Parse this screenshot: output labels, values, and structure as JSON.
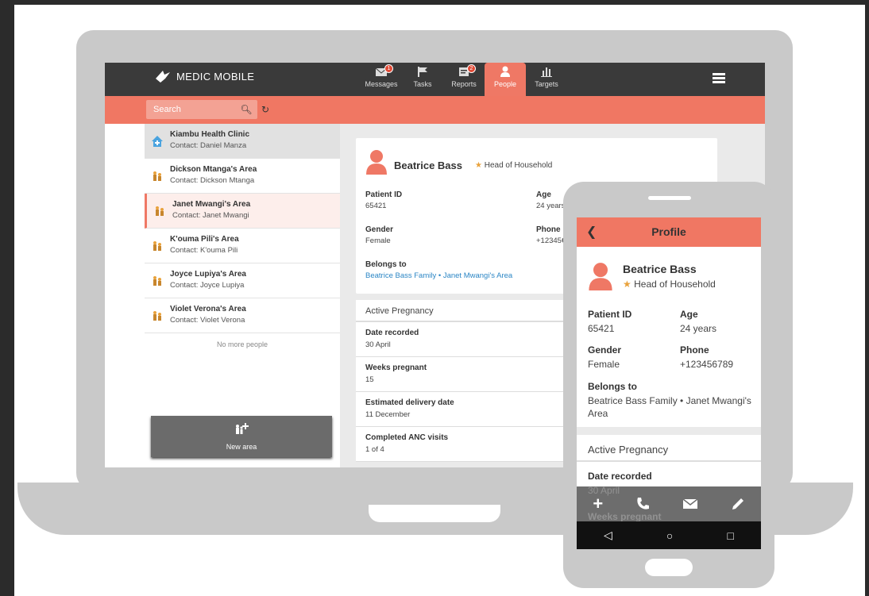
{
  "app": {
    "logo_text": "MEDIC MOBILE",
    "accent": "#f07763",
    "dark": "#3a3a3a"
  },
  "tabs": [
    {
      "label": "Messages",
      "icon": "envelope-icon",
      "badge": "1"
    },
    {
      "label": "Tasks",
      "icon": "flag-icon"
    },
    {
      "label": "Reports",
      "icon": "report-icon",
      "badge": "2"
    },
    {
      "label": "People",
      "icon": "person-icon",
      "active": true
    },
    {
      "label": "Targets",
      "icon": "bar-chart-icon"
    }
  ],
  "search": {
    "placeholder": "Search"
  },
  "people": [
    {
      "title": "Kiambu Health Clinic",
      "contact": "Contact: Daniel Manza",
      "icon": "clinic-icon"
    },
    {
      "title": "Dickson Mtanga's Area",
      "contact": "Contact: Dickson Mtanga",
      "icon": "family-icon"
    },
    {
      "title": "Janet Mwangi's Area",
      "contact": "Contact: Janet Mwangi",
      "icon": "family-icon"
    },
    {
      "title": "K'ouma Pili's Area",
      "contact": "Contact: K'ouma Pili",
      "icon": "family-icon"
    },
    {
      "title": "Joyce Lupiya's Area",
      "contact": "Contact: Joyce Lupiya",
      "icon": "family-icon"
    },
    {
      "title": "Violet Verona's Area",
      "contact": "Contact: Violet Verona",
      "icon": "family-icon"
    }
  ],
  "no_more": "No more people",
  "new_area": "New area",
  "profile": {
    "name": "Beatrice Bass",
    "role": "Head of Household",
    "patient_id_label": "Patient ID",
    "patient_id": "65421",
    "age_label": "Age",
    "age_desktop": "24 years",
    "age": "24 years",
    "gender_label": "Gender",
    "gender": "Female",
    "phone_label": "Phone",
    "phone_desktop": "+12345€",
    "phone": "+123456789",
    "belongs_label": "Belongs to",
    "belongs": "Beatrice Bass Family • Janet Mwangi's Area"
  },
  "pregnancy": {
    "title": "Active Pregnancy",
    "rows": [
      {
        "label": "Date recorded",
        "value": "30 April"
      },
      {
        "label": "Weeks pregnant",
        "value": "15"
      },
      {
        "label": "Estimated delivery date",
        "value": "11 December"
      },
      {
        "label": "Completed ANC visits",
        "value": "1 of 4"
      }
    ]
  },
  "phone_app": {
    "title": "Profile",
    "belongs_line1": "Beatrice Bass Family • Janet Mwangi's",
    "belongs_line2": "Area",
    "date_value": "30 April",
    "weeks_label": "Weeks pregnant"
  }
}
